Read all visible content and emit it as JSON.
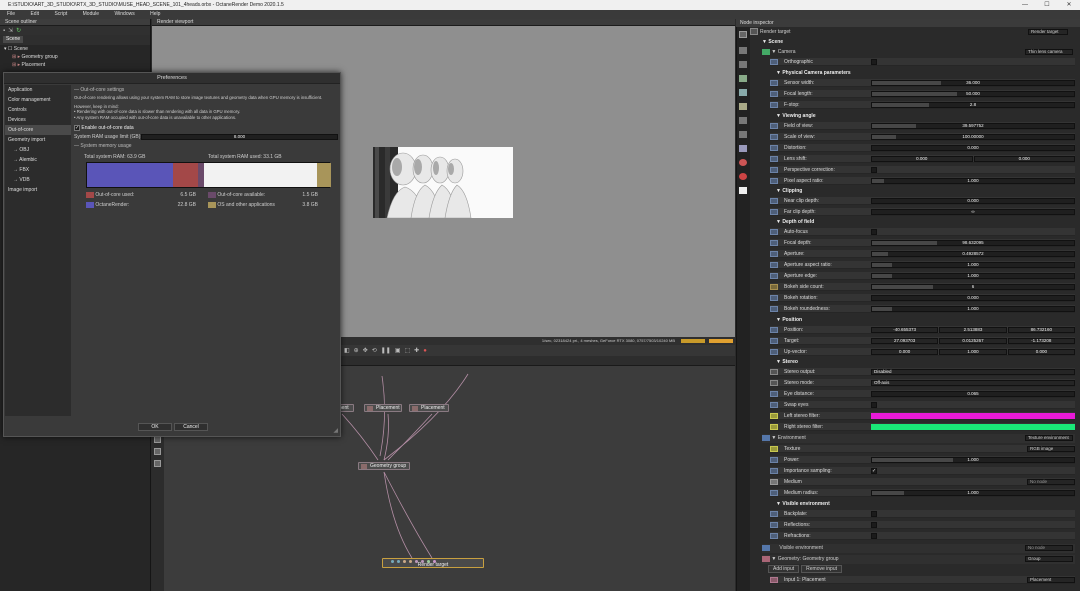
{
  "app": {
    "title": "E:\\STUDIO\\ART_3D_STUDIO\\RTX_3D_STUDIO\\MUSE_HEAD_SCENE_101_4heads.orbx - OctaneRender Demo 2020.1.5",
    "window_controls": [
      "—",
      "☐",
      "✕"
    ]
  },
  "menu": [
    "File",
    "Edit",
    "Script",
    "Module",
    "Windows",
    "Help"
  ],
  "outliner": {
    "title": "Scene outliner",
    "tab": "Scene",
    "tree": [
      "Scene",
      "Geometry group",
      "Placement"
    ]
  },
  "viewport": {
    "title": "Render viewport",
    "status": "1/sec, 02318424 pri., 4 meshes, GeForce RTX 3080, 0757/7503/10240 MB"
  },
  "nodegraph": {
    "nodes": {
      "placement_a": "Placement",
      "placement_b": "Placement",
      "placement_c": "Placement",
      "geometry_group": "Geometry group",
      "render_target": "Render target"
    }
  },
  "inspector": {
    "title": "Node inspector",
    "target_label": "Render target",
    "target_value": "Render target",
    "sections": {
      "scene": "Scene",
      "camera": "Camera",
      "camera_type": "Thin lens camera",
      "physical": "Physical Camera parameters",
      "viewing": "Viewing angle",
      "clipping": "Clipping",
      "dof": "Depth of field",
      "position": "Position",
      "stereo": "Stereo",
      "environment": "Environment",
      "env_type": "Texture environment",
      "visible_env": "Visible environment",
      "visible_env_row": "Visible environment",
      "visible_env_val": "No node",
      "geometry": "Geometry: Geometry group",
      "geometry_val": "Group",
      "add_input": "Add input",
      "remove_input": "Remove input",
      "input1": "Input 1: Placement",
      "input1_val": "Placement"
    },
    "rows": {
      "orthographic": "Orthographic",
      "sensor_width": "Sensor width:",
      "sensor_width_v": "36.000",
      "focal_length": "Focal length:",
      "focal_length_v": "50.000",
      "fstop": "F-stop:",
      "fstop_v": "2.8",
      "fov": "Field of view:",
      "fov_v": "39.597752",
      "scale_view": "Scale of view:",
      "scale_view_v": "100.00000",
      "distortion": "Distortion:",
      "distortion_v": "0.000",
      "lens_shift": "Lens shift:",
      "lens_shift_a": "0.000",
      "lens_shift_b": "0.000",
      "persp_corr": "Perspective correction:",
      "pixel_aspect": "Pixel aspect ratio:",
      "pixel_aspect_v": "1.000",
      "near_clip": "Near clip depth:",
      "near_clip_v": "0.000",
      "far_clip": "Far clip depth:",
      "far_clip_v": "∞",
      "autofocus": "Auto-focus",
      "focal_depth": "Focal depth:",
      "focal_depth_v": "98.632095",
      "aperture": "Aperture:",
      "aperture_v": "0.4928572",
      "aperture_aspect": "Aperture aspect ratio:",
      "aperture_aspect_v": "1.000",
      "aperture_edge": "Aperture edge:",
      "aperture_edge_v": "1.000",
      "bokeh_sides": "Bokeh side count:",
      "bokeh_sides_v": "6",
      "bokeh_rot": "Bokeh rotation:",
      "bokeh_rot_v": "0.000",
      "bokeh_round": "Bokeh roundedness:",
      "bokeh_round_v": "1.000",
      "pos": "Position:",
      "pos_v": [
        "-40.655373",
        "2.513883",
        "86.732160"
      ],
      "target": "Target:",
      "target_v": [
        "27.093703",
        "0.0125267",
        "-1.173208"
      ],
      "upvector": "Up-vector:",
      "upvector_v": [
        "0.000",
        "1.000",
        "0.000"
      ],
      "stereo_output": "Stereo output:",
      "stereo_output_v": "Disabled",
      "stereo_mode": "Stereo mode:",
      "stereo_mode_v": "Off-axis",
      "eye_distance": "Eye distance:",
      "eye_distance_v": "0.065",
      "swap_eyes": "Swap eyes",
      "left_filter": "Left stereo filter:",
      "right_filter": "Right stereo filter:",
      "texture": "Texture",
      "texture_v": "RGB image",
      "power": "Power:",
      "power_v": "1.000",
      "importance": "Importance sampling:",
      "medium": "Medium",
      "medium_v": "No node",
      "medium_radius": "Medium radius:",
      "medium_radius_v": "1.000",
      "backplate": "Backplate:",
      "reflections": "Reflections:",
      "refractions": "Refractions:"
    }
  },
  "prefs": {
    "title": "Preferences",
    "nav": [
      "Application",
      "Color management",
      "Controls",
      "Devices",
      "Out-of-core",
      "Geometry import",
      "OBJ",
      "Alembic",
      "FBX",
      "VDB",
      "Image import"
    ],
    "group_title": "Out-of-core settings",
    "intro": "Out-of-core rendering allows using your system RAM to store image textures and geometry data when GPU memory is insufficient.",
    "notes": "However, keep in mind:\n• Rendering with out-of-core data is slower than rendering with all data in GPU memory.\n• Any system RAM occupied with out-of-core data is unavailable to other applications.",
    "enable_label": "Enable out-of-core data",
    "limit_label": "System RAM usage limit (GB):",
    "limit_value": "8.000",
    "mem_group": "System memory usage",
    "total_ram": "Total system RAM: 63.9 GB",
    "total_used": "Total system RAM used: 33.1 GB",
    "legend": [
      {
        "label": "Out-of-core used:",
        "value": "6.5 GB",
        "color": "#a34848"
      },
      {
        "label": "Out-of-core available:",
        "value": "1.5 GB",
        "color": "#6a4a6a"
      },
      {
        "label": "OctaneRender:",
        "value": "22.8 GB",
        "color": "#5a55b8"
      },
      {
        "label": "OS and other applications",
        "value": "3.8 GB",
        "color": "#a8955a"
      }
    ],
    "ok": "OK",
    "cancel": "Cancel"
  }
}
